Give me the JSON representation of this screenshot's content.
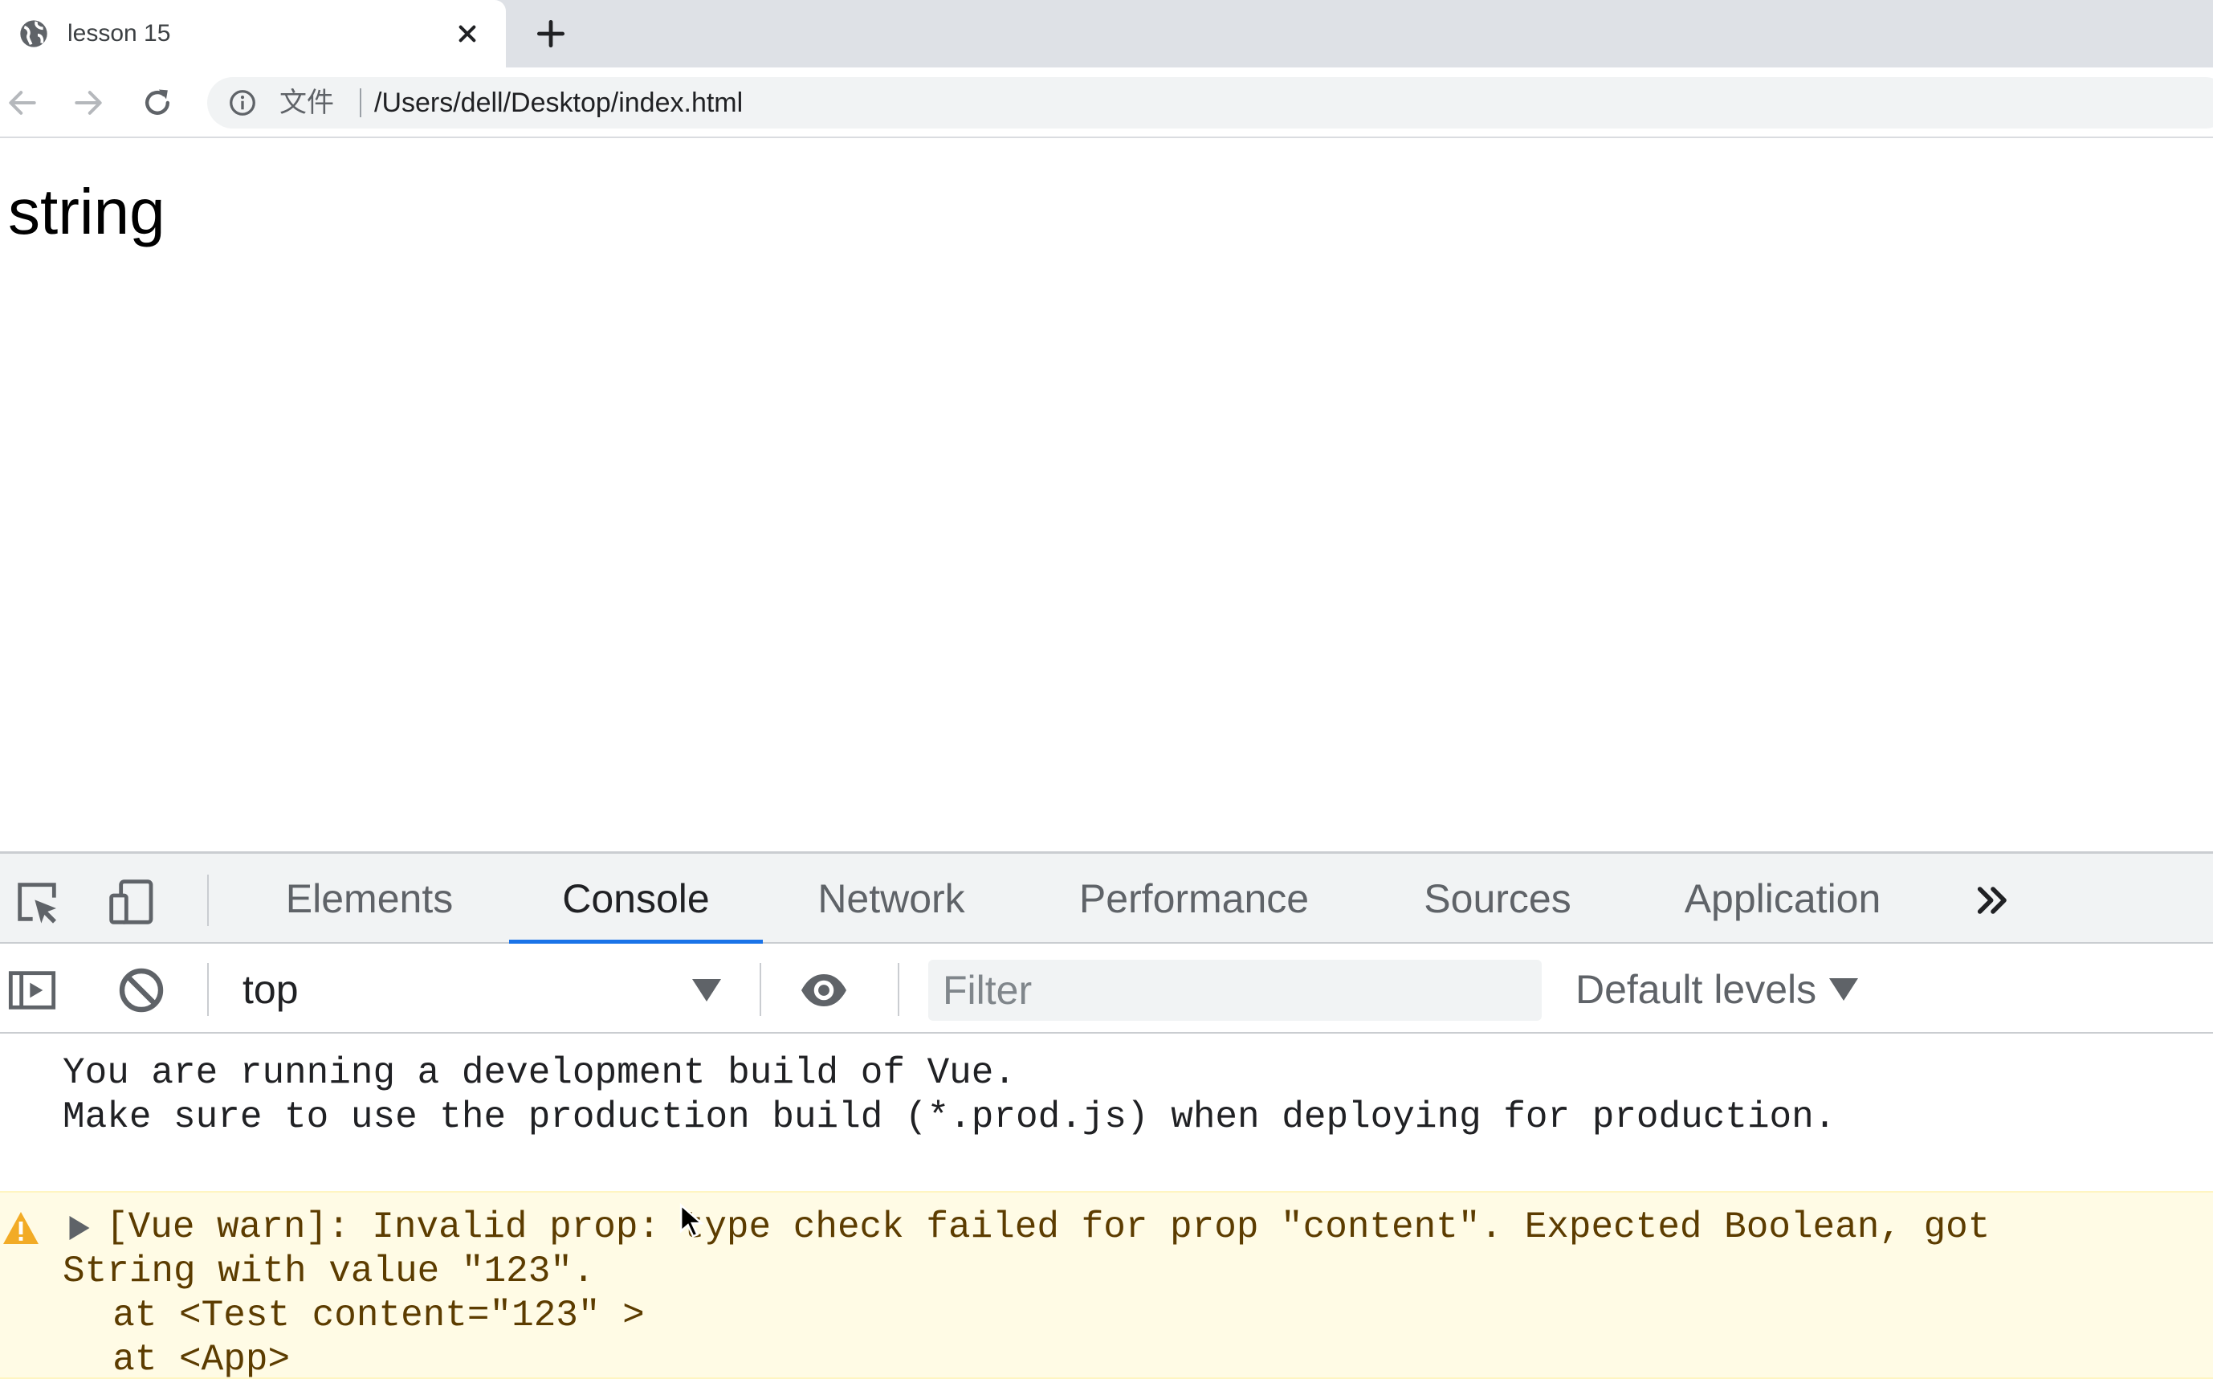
{
  "browser": {
    "tab": {
      "title": "lesson 15",
      "favicon": "globe-icon",
      "close_icon": "close-icon"
    },
    "new_tab_icon": "plus-icon",
    "nav": {
      "back_icon": "arrow-left-icon",
      "forward_icon": "arrow-right-icon",
      "reload_icon": "reload-icon"
    },
    "omnibox": {
      "info_icon": "info-icon",
      "scheme_label": "文件",
      "url": "/Users/dell/Desktop/index.html"
    }
  },
  "page": {
    "content_text": "string"
  },
  "devtools": {
    "toolbar_icons": [
      "inspect-element-icon",
      "device-toolbar-icon"
    ],
    "tabs": [
      {
        "label": "Elements",
        "active": false
      },
      {
        "label": "Console",
        "active": true
      },
      {
        "label": "Network",
        "active": false
      },
      {
        "label": "Performance",
        "active": false
      },
      {
        "label": "Sources",
        "active": false
      },
      {
        "label": "Application",
        "active": false
      }
    ],
    "more_tabs_icon": "chevron-double-right-icon",
    "console_bar": {
      "sidebar_icon": "sidebar-toggle-icon",
      "clear_icon": "clear-console-icon",
      "context": "top",
      "eye_icon": "eye-icon",
      "filter_placeholder": "Filter",
      "filter_value": "",
      "levels": "Default levels"
    },
    "messages": {
      "info": {
        "lines": [
          "You are running a development build of Vue.",
          "Make sure to use the production build (*.prod.js) when deploying for production."
        ]
      },
      "warning": {
        "icon": "warning-icon",
        "lines": [
          "[Vue warn]: Invalid prop: type check failed for prop \"content\". Expected Boolean, got",
          "String with value \"123\".",
          "  at <Test content=\"123\" >",
          "  at <App>"
        ]
      }
    }
  },
  "colors": {
    "accent": "#1a73e8",
    "warning_background": "#fffbe5",
    "warning_text": "#5c3c00",
    "warning_icon": "#f2ab26"
  }
}
